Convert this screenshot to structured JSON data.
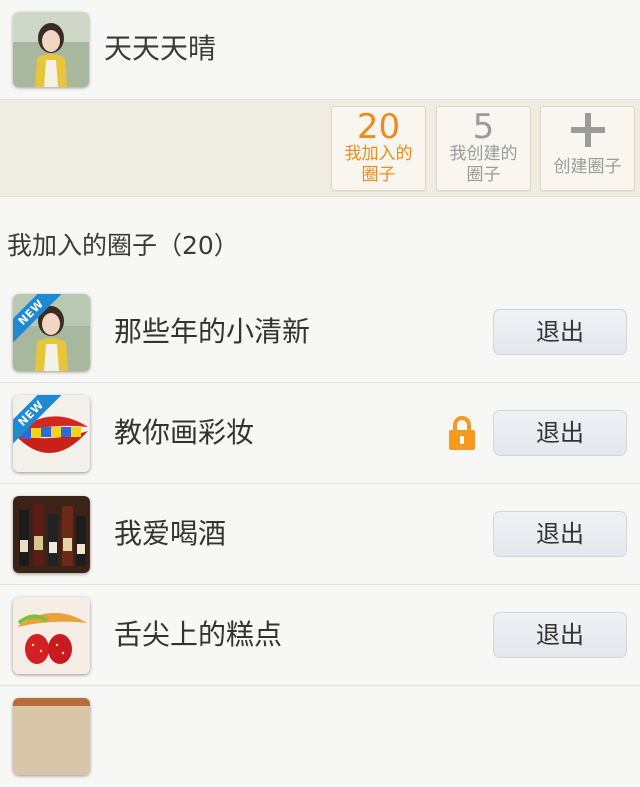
{
  "profile": {
    "name": "天天天晴",
    "avatar_icon": "user-avatar"
  },
  "stats": {
    "joined": {
      "count": "20",
      "label": "我加入的圈子"
    },
    "created": {
      "count": "5",
      "label": "我创建的圈子"
    },
    "create": {
      "icon": "plus-icon",
      "label": "创建圈子"
    },
    "active_color": "#f08a1c",
    "inactive_color": "#9b9b9b"
  },
  "section_title": "我加入的圈子（20）",
  "circles": [
    {
      "title": "那些年的小清新",
      "badge": "NEW",
      "locked": false,
      "action": "退出"
    },
    {
      "title": "教你画彩妆",
      "badge": "NEW",
      "locked": true,
      "action": "退出"
    },
    {
      "title": "我爱喝酒",
      "badge": "",
      "locked": false,
      "action": "退出"
    },
    {
      "title": "舌尖上的糕点",
      "badge": "",
      "locked": false,
      "action": "退出"
    }
  ]
}
